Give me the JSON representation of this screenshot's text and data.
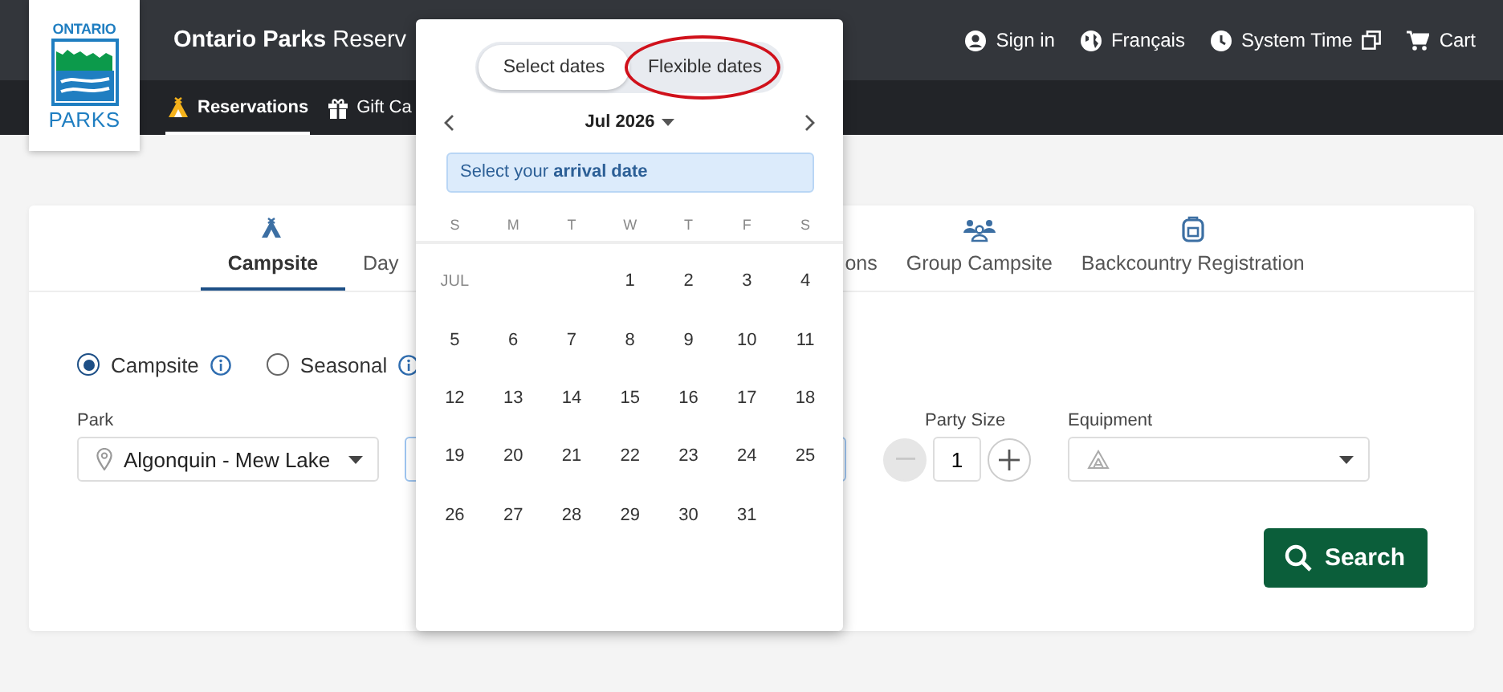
{
  "header": {
    "logo": {
      "top": "ONTARIO",
      "bottom": "PARKS"
    },
    "title": "**Ontario Parks** Reserv",
    "links": [
      {
        "kind": "account",
        "label": "Sign in"
      },
      {
        "kind": "language",
        "label": "Français"
      },
      {
        "kind": "time",
        "label": "System Time"
      },
      {
        "kind": "cart",
        "label": "Cart"
      }
    ]
  },
  "nav": [
    {
      "kind": "tent",
      "label": "Reservations",
      "selected": true
    },
    {
      "kind": "gift",
      "label": "Gift Ca",
      "selected": false
    }
  ],
  "tabs": [
    {
      "kind": "tent",
      "label": "Campsite",
      "selected": true
    },
    {
      "kind": "none",
      "label": "Day",
      "selected": false
    },
    {
      "kind": "none",
      "label": "ons",
      "selected": false
    },
    {
      "kind": "group",
      "label": "Group Campsite",
      "selected": false
    },
    {
      "kind": "backpack",
      "label": "Backcountry Registration",
      "selected": false
    }
  ],
  "booking_types": [
    {
      "label": "Campsite",
      "selected": true
    },
    {
      "label": "Seasonal",
      "selected": false
    }
  ],
  "park": {
    "label": "Park",
    "value": "Algonquin - Mew Lake"
  },
  "party_size": {
    "label": "Party Size",
    "value": "1",
    "minus_disabled": true
  },
  "equipment": {
    "label": "Equipment"
  },
  "search_button": "Search",
  "date_picker": {
    "modes": [
      {
        "label": "Select dates",
        "selected": true,
        "highlighted": false
      },
      {
        "label": "Flexible dates",
        "selected": false,
        "highlighted": true
      }
    ],
    "month": "Jul 2026",
    "banner": "Select your **arrival date**",
    "weekdays": [
      "S",
      "M",
      "T",
      "W",
      "T",
      "F",
      "S"
    ],
    "weeks": [
      [
        {
          "kind": "month",
          "text": "JUL"
        },
        {
          "kind": "blank"
        },
        {
          "kind": "blank"
        },
        {
          "kind": "day",
          "text": "1"
        },
        {
          "kind": "day",
          "text": "2"
        },
        {
          "kind": "day",
          "text": "3"
        },
        {
          "kind": "day",
          "text": "4"
        }
      ],
      [
        {
          "kind": "day",
          "text": "5"
        },
        {
          "kind": "day",
          "text": "6"
        },
        {
          "kind": "day",
          "text": "7"
        },
        {
          "kind": "day",
          "text": "8"
        },
        {
          "kind": "day",
          "text": "9"
        },
        {
          "kind": "day",
          "text": "10"
        },
        {
          "kind": "day",
          "text": "11"
        }
      ],
      [
        {
          "kind": "day",
          "text": "12"
        },
        {
          "kind": "day",
          "text": "13"
        },
        {
          "kind": "day",
          "text": "14"
        },
        {
          "kind": "day",
          "text": "15"
        },
        {
          "kind": "day",
          "text": "16"
        },
        {
          "kind": "day",
          "text": "17"
        },
        {
          "kind": "day",
          "text": "18"
        }
      ],
      [
        {
          "kind": "day",
          "text": "19"
        },
        {
          "kind": "day",
          "text": "20"
        },
        {
          "kind": "day",
          "text": "21"
        },
        {
          "kind": "day",
          "text": "22"
        },
        {
          "kind": "day",
          "text": "23"
        },
        {
          "kind": "day",
          "text": "24"
        },
        {
          "kind": "day",
          "text": "25"
        }
      ],
      [
        {
          "kind": "day",
          "text": "26"
        },
        {
          "kind": "day",
          "text": "27"
        },
        {
          "kind": "day",
          "text": "28"
        },
        {
          "kind": "day",
          "text": "29"
        },
        {
          "kind": "day",
          "text": "30"
        },
        {
          "kind": "day",
          "text": "31"
        }
      ]
    ]
  }
}
